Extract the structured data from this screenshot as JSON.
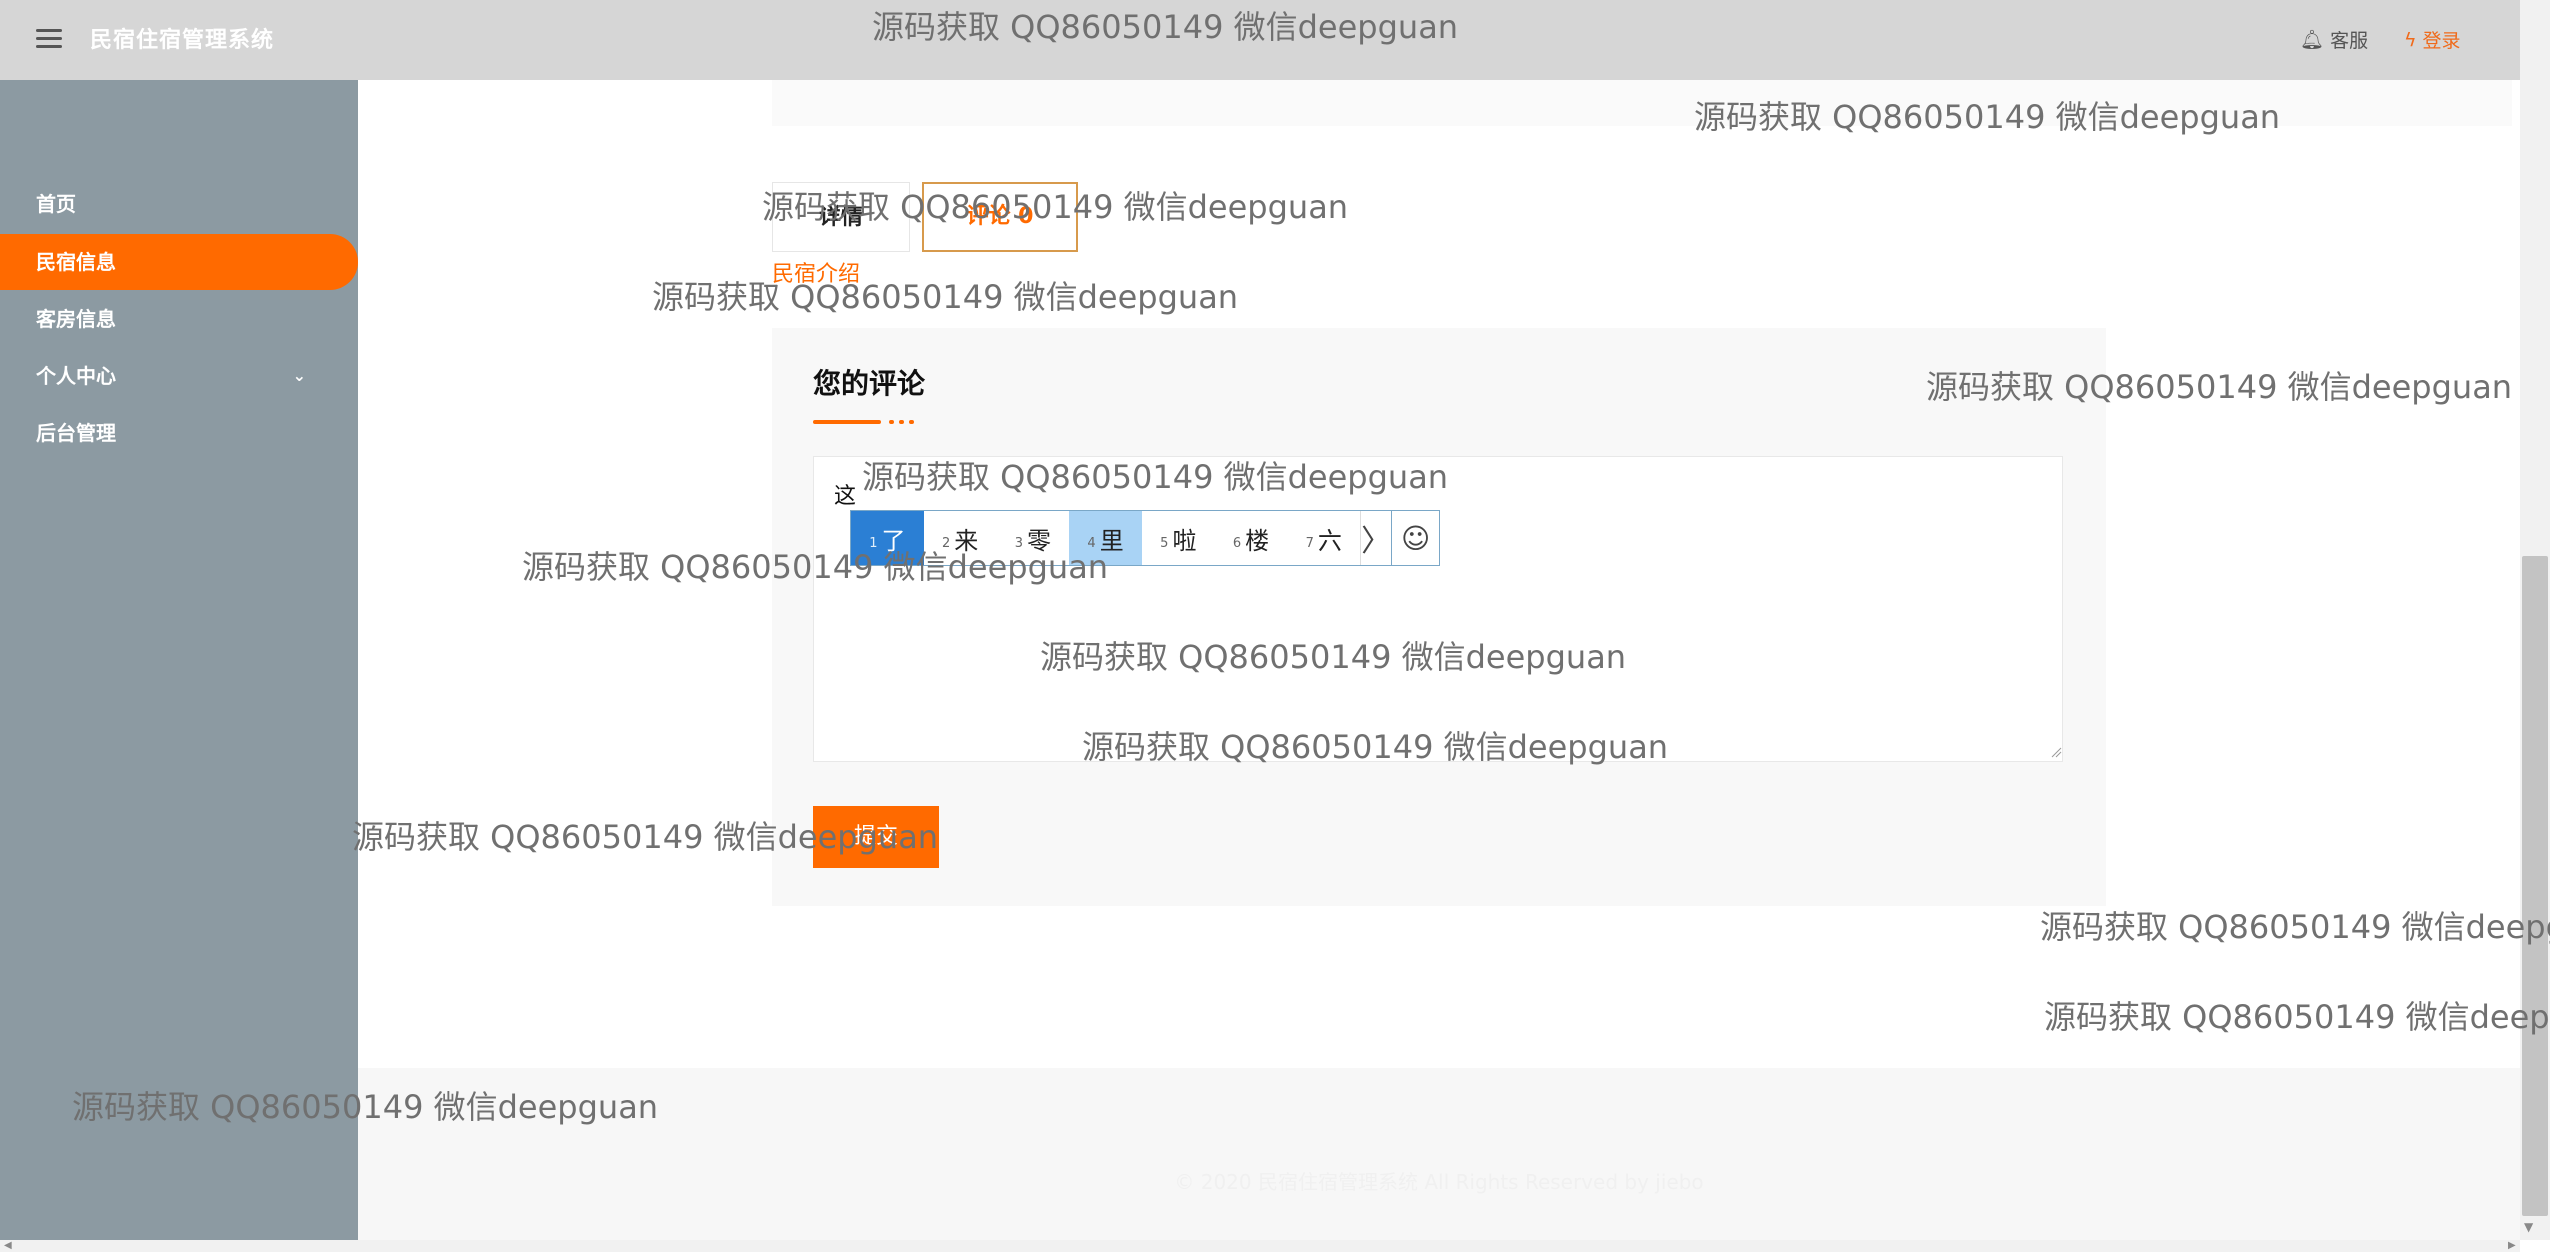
{
  "header": {
    "title": "民宿住宿管理系统",
    "support_label": "客服",
    "login_label": "登录"
  },
  "sidebar": {
    "items": [
      {
        "label": "首页"
      },
      {
        "label": "民宿信息"
      },
      {
        "label": "客房信息"
      },
      {
        "label": "个人中心"
      },
      {
        "label": "后台管理"
      }
    ]
  },
  "tabs": {
    "detail": "详情",
    "comments": "评论 0"
  },
  "homestay_intro_link": "民宿介绍",
  "comment_form": {
    "heading": "您的评论",
    "textarea_value": "这",
    "submit_label": "提交"
  },
  "ime": {
    "candidates": [
      {
        "num": "1",
        "text": "了"
      },
      {
        "num": "2",
        "text": "来"
      },
      {
        "num": "3",
        "text": "零"
      },
      {
        "num": "4",
        "text": "里"
      },
      {
        "num": "5",
        "text": "啦"
      },
      {
        "num": "6",
        "text": "楼"
      },
      {
        "num": "7",
        "text": "六"
      }
    ],
    "next_symbol": "〉",
    "emoji_symbol": "☺"
  },
  "footer": {
    "text": "© 2020 民宿住宿管理系统 All Rights Reserved by jiebo"
  },
  "watermark": "源码获取 QQ86050149 微信deepguan",
  "colors": {
    "accent": "#ff6a00",
    "sidebar": "#8c9aa2",
    "header": "#d6d6d6"
  }
}
